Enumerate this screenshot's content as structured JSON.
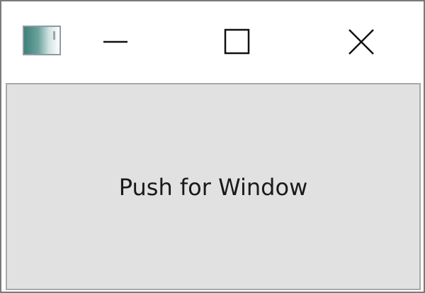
{
  "window": {
    "icons": {
      "app": "app-window-icon",
      "minimize": "minimize-icon",
      "maximize": "maximize-icon",
      "close": "close-icon"
    }
  },
  "main": {
    "button_label": "Push for Window"
  },
  "colors": {
    "client_background": "#e1e1e1",
    "titlebar_background": "#ffffff",
    "text": "#1a1a1a"
  }
}
